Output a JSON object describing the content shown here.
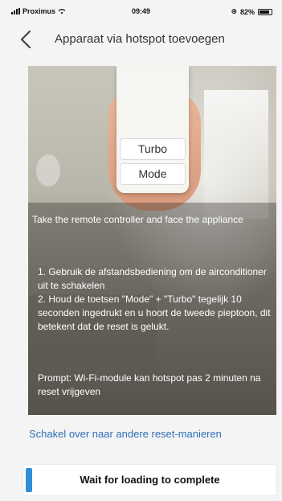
{
  "status_bar": {
    "carrier": "Proximus",
    "time": "09:49",
    "battery": "82%"
  },
  "nav": {
    "title": "Apparaat via hotspot toevoegen"
  },
  "remote": {
    "turbo_label": "Turbo",
    "mode_label": "Mode"
  },
  "instructions": {
    "line1": "Take the remote controller and face the appliance",
    "line2": "1. Gebruik de afstandsbediening om de airconditioner uit te schakelen\n2. Houd de toetsen \"Mode\" + \"Turbo\" tegelijk 10 seconden ingedrukt en u hoort de tweede pieptoon, dit betekent dat de reset is gelukt.",
    "line3": "Prompt: Wi-Fi-module kan hotspot pas 2 minuten na reset vrijgeven"
  },
  "switch_link": "Schakel over naar andere reset-manieren",
  "loading": {
    "text": "Wait for loading to complete"
  },
  "colors": {
    "link": "#2f6fb8",
    "accent": "#2e8fd8"
  }
}
